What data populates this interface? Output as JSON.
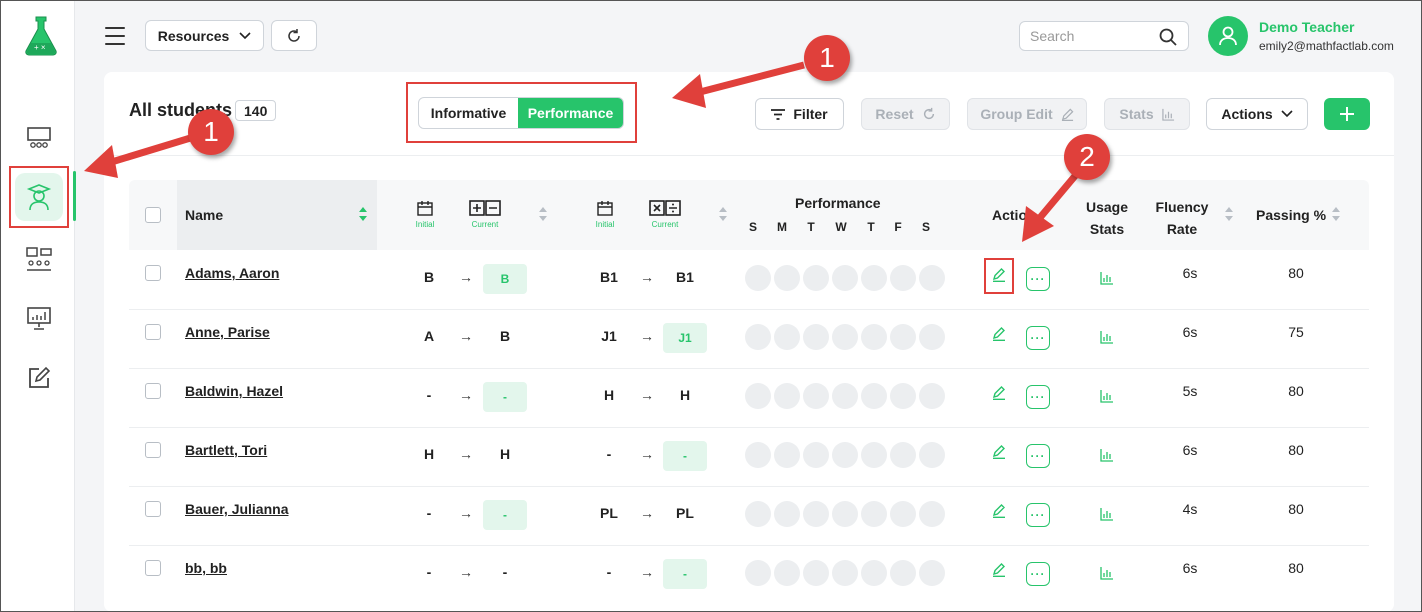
{
  "header": {
    "resources_label": "Resources",
    "search_placeholder": "Search",
    "user_name": "Demo Teacher",
    "user_email": "emily2@mathfactlab.com"
  },
  "toolbar": {
    "title": "All students",
    "count": "140",
    "view_toggle": [
      "Informative",
      "Performance"
    ],
    "active_view": "Performance",
    "filter_label": "Filter",
    "reset_label": "Reset",
    "group_edit_label": "Group Edit",
    "stats_label": "Stats",
    "actions_label": "Actions"
  },
  "table": {
    "headers": {
      "name": "Name",
      "initial": "Initial",
      "current": "Current",
      "performance": "Performance",
      "actions": "Actio",
      "usage_stats_1": "Usage",
      "usage_stats_2": "Stats",
      "fluency_1": "Fluency",
      "fluency_2": "Rate",
      "passing": "Passing %"
    },
    "days": [
      "S",
      "M",
      "T",
      "W",
      "T",
      "F",
      "S"
    ],
    "arrow": "→",
    "more": "···",
    "rows": [
      {
        "name": "Adams, Aaron",
        "add_initial": "B",
        "add_current": "B",
        "mul_initial": "B1",
        "mul_current": "B1",
        "fluency": "6s",
        "passing": "80"
      },
      {
        "name": "Anne, Parise",
        "add_initial": "A",
        "add_current": "B",
        "mul_initial": "J1",
        "mul_current": "J1",
        "fluency": "6s",
        "passing": "75"
      },
      {
        "name": "Baldwin, Hazel",
        "add_initial": "-",
        "add_current": "-",
        "mul_initial": "H",
        "mul_current": "H",
        "fluency": "5s",
        "passing": "80"
      },
      {
        "name": "Bartlett, Tori",
        "add_initial": "H",
        "add_current": "H",
        "mul_initial": "-",
        "mul_current": "-",
        "fluency": "6s",
        "passing": "80"
      },
      {
        "name": "Bauer, Julianna",
        "add_initial": "-",
        "add_current": "-",
        "mul_initial": "PL",
        "mul_current": "PL",
        "fluency": "4s",
        "passing": "80"
      },
      {
        "name": "bb, bb",
        "add_initial": "-",
        "add_current": "-",
        "mul_initial": "-",
        "mul_current": "-",
        "fluency": "6s",
        "passing": "80"
      }
    ]
  },
  "annotations": {
    "badge_1": "1",
    "badge_2": "2"
  },
  "colors": {
    "accent": "#27c46b",
    "annotation": "#e0403b"
  }
}
